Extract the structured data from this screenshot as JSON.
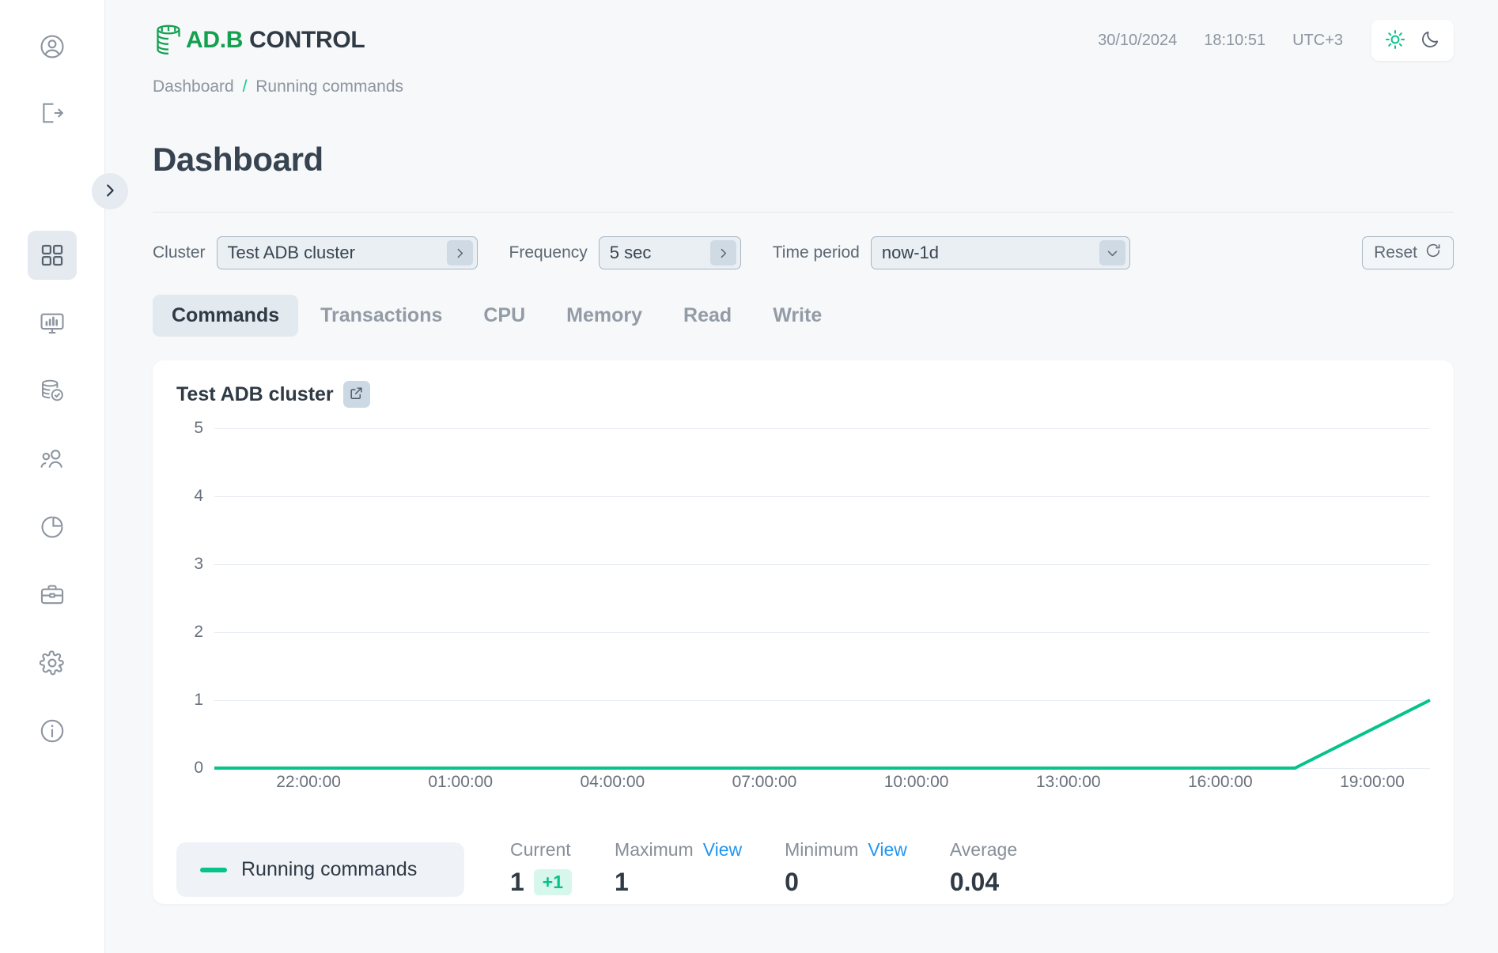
{
  "sidebar": {
    "items": [
      {
        "icon": "user-circle-icon",
        "name": "sidebar-item-profile",
        "active": false
      },
      {
        "icon": "logout-icon",
        "name": "sidebar-item-logout",
        "active": false
      },
      {
        "icon": "grid-dashboard-icon",
        "name": "sidebar-item-dashboard",
        "active": true
      },
      {
        "icon": "monitor-chart-icon",
        "name": "sidebar-item-monitoring",
        "active": false
      },
      {
        "icon": "database-check-icon",
        "name": "sidebar-item-databases",
        "active": false
      },
      {
        "icon": "users-icon",
        "name": "sidebar-item-users",
        "active": false
      },
      {
        "icon": "pie-chart-icon",
        "name": "sidebar-item-reports",
        "active": false
      },
      {
        "icon": "briefcase-icon",
        "name": "sidebar-item-jobs",
        "active": false
      },
      {
        "icon": "gear-icon",
        "name": "sidebar-item-settings",
        "active": false
      },
      {
        "icon": "info-circle-icon",
        "name": "sidebar-item-info",
        "active": false
      }
    ],
    "toggle_icon": "chevron-right-icon"
  },
  "header": {
    "logo_prefix": "AD.B",
    "logo_suffix": " CONTROL",
    "logo_full": "AD.B CONTROL",
    "date": "30/10/2024",
    "time": "18:10:51",
    "timezone": "UTC+3",
    "theme_light_icon": "sun-icon",
    "theme_dark_icon": "moon-icon"
  },
  "breadcrumb": {
    "root": "Dashboard",
    "separator": "/",
    "current": "Running commands"
  },
  "page": {
    "title": "Dashboard"
  },
  "filters": {
    "cluster_label": "Cluster",
    "cluster_value": "Test ADB cluster",
    "cluster_chevron": "chevron-right-icon",
    "frequency_label": "Frequency",
    "frequency_value": "5 sec",
    "frequency_chevron": "chevron-right-icon",
    "period_label": "Time period",
    "period_value": "now-1d",
    "period_chevron": "chevron-down-icon",
    "reset_label": "Reset",
    "reset_icon": "refresh-icon"
  },
  "tabs": [
    {
      "label": "Commands",
      "active": true
    },
    {
      "label": "Transactions",
      "active": false
    },
    {
      "label": "CPU",
      "active": false
    },
    {
      "label": "Memory",
      "active": false
    },
    {
      "label": "Read",
      "active": false
    },
    {
      "label": "Write",
      "active": false
    }
  ],
  "card": {
    "title": "Test ADB cluster",
    "expand_icon": "external-link-icon"
  },
  "chart_data": {
    "type": "line",
    "title": "Test ADB cluster",
    "xlabel": "",
    "ylabel": "",
    "ylim": [
      0,
      5
    ],
    "yticks": [
      0,
      1,
      2,
      3,
      4,
      5
    ],
    "grid": true,
    "legend_position": "bottom",
    "xticks": [
      "22:00:00",
      "01:00:00",
      "04:00:00",
      "07:00:00",
      "10:00:00",
      "13:00:00",
      "16:00:00",
      "19:00:00"
    ],
    "series": [
      {
        "name": "Running commands",
        "color": "#05c38a",
        "x": [
          "19:00:00",
          "22:00:00",
          "01:00:00",
          "04:00:00",
          "07:00:00",
          "10:00:00",
          "13:00:00",
          "16:00:00",
          "17:30:00",
          "18:10:51"
        ],
        "values": [
          0,
          0,
          0,
          0,
          0,
          0,
          0,
          0,
          0,
          1
        ]
      }
    ]
  },
  "stats": {
    "legend_label": "Running commands",
    "current_label": "Current",
    "current_value": "1",
    "current_badge": "+1",
    "maximum_label": "Maximum",
    "maximum_view": "View",
    "maximum_value": "1",
    "minimum_label": "Minimum",
    "minimum_view": "View",
    "minimum_value": "0",
    "average_label": "Average",
    "average_value": "0.04"
  },
  "colors": {
    "accent_green": "#05c38a",
    "brand_green": "#12a14f",
    "brand_lime": "#7fb93c",
    "link_blue": "#2196f3",
    "text_dark": "#2f3a45",
    "bg": "#f6f8fa"
  }
}
